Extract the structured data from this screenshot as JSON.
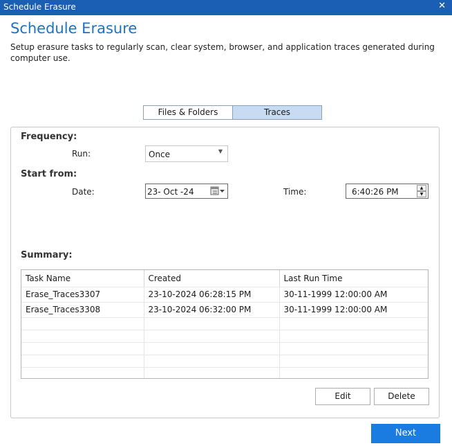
{
  "window": {
    "title": "Schedule Erasure",
    "close_glyph": "✕"
  },
  "header": {
    "title": "Schedule Erasure",
    "description": "Setup erasure tasks to regularly scan, clear system, browser, and application traces generated during computer use."
  },
  "tabs": [
    {
      "label": "Files & Folders",
      "active": false
    },
    {
      "label": "Traces",
      "active": true
    }
  ],
  "frequency": {
    "heading": "Frequency:",
    "run_label": "Run:",
    "run_value": "Once"
  },
  "start": {
    "heading": "Start from:",
    "date_label": "Date:",
    "date_value": "23- Oct -24",
    "time_label": "Time:",
    "time_value": "6:40:26 PM"
  },
  "summary": {
    "heading": "Summary:",
    "columns": [
      "Task Name",
      "Created",
      "Last Run Time"
    ],
    "rows": [
      [
        "Erase_Traces3307",
        "23-10-2024 06:28:15 PM",
        "30-11-1999 12:00:00 AM"
      ],
      [
        "Erase_Traces3308",
        "23-10-2024 06:32:00 PM",
        "30-11-1999 12:00:00 AM"
      ]
    ]
  },
  "buttons": {
    "edit": "Edit",
    "delete": "Delete",
    "next": "Next"
  },
  "colors": {
    "titlebar": "#1a5fb4",
    "accent": "#1a73c8",
    "next_button": "#1a7be0",
    "active_tab": "#c7dcf2"
  }
}
